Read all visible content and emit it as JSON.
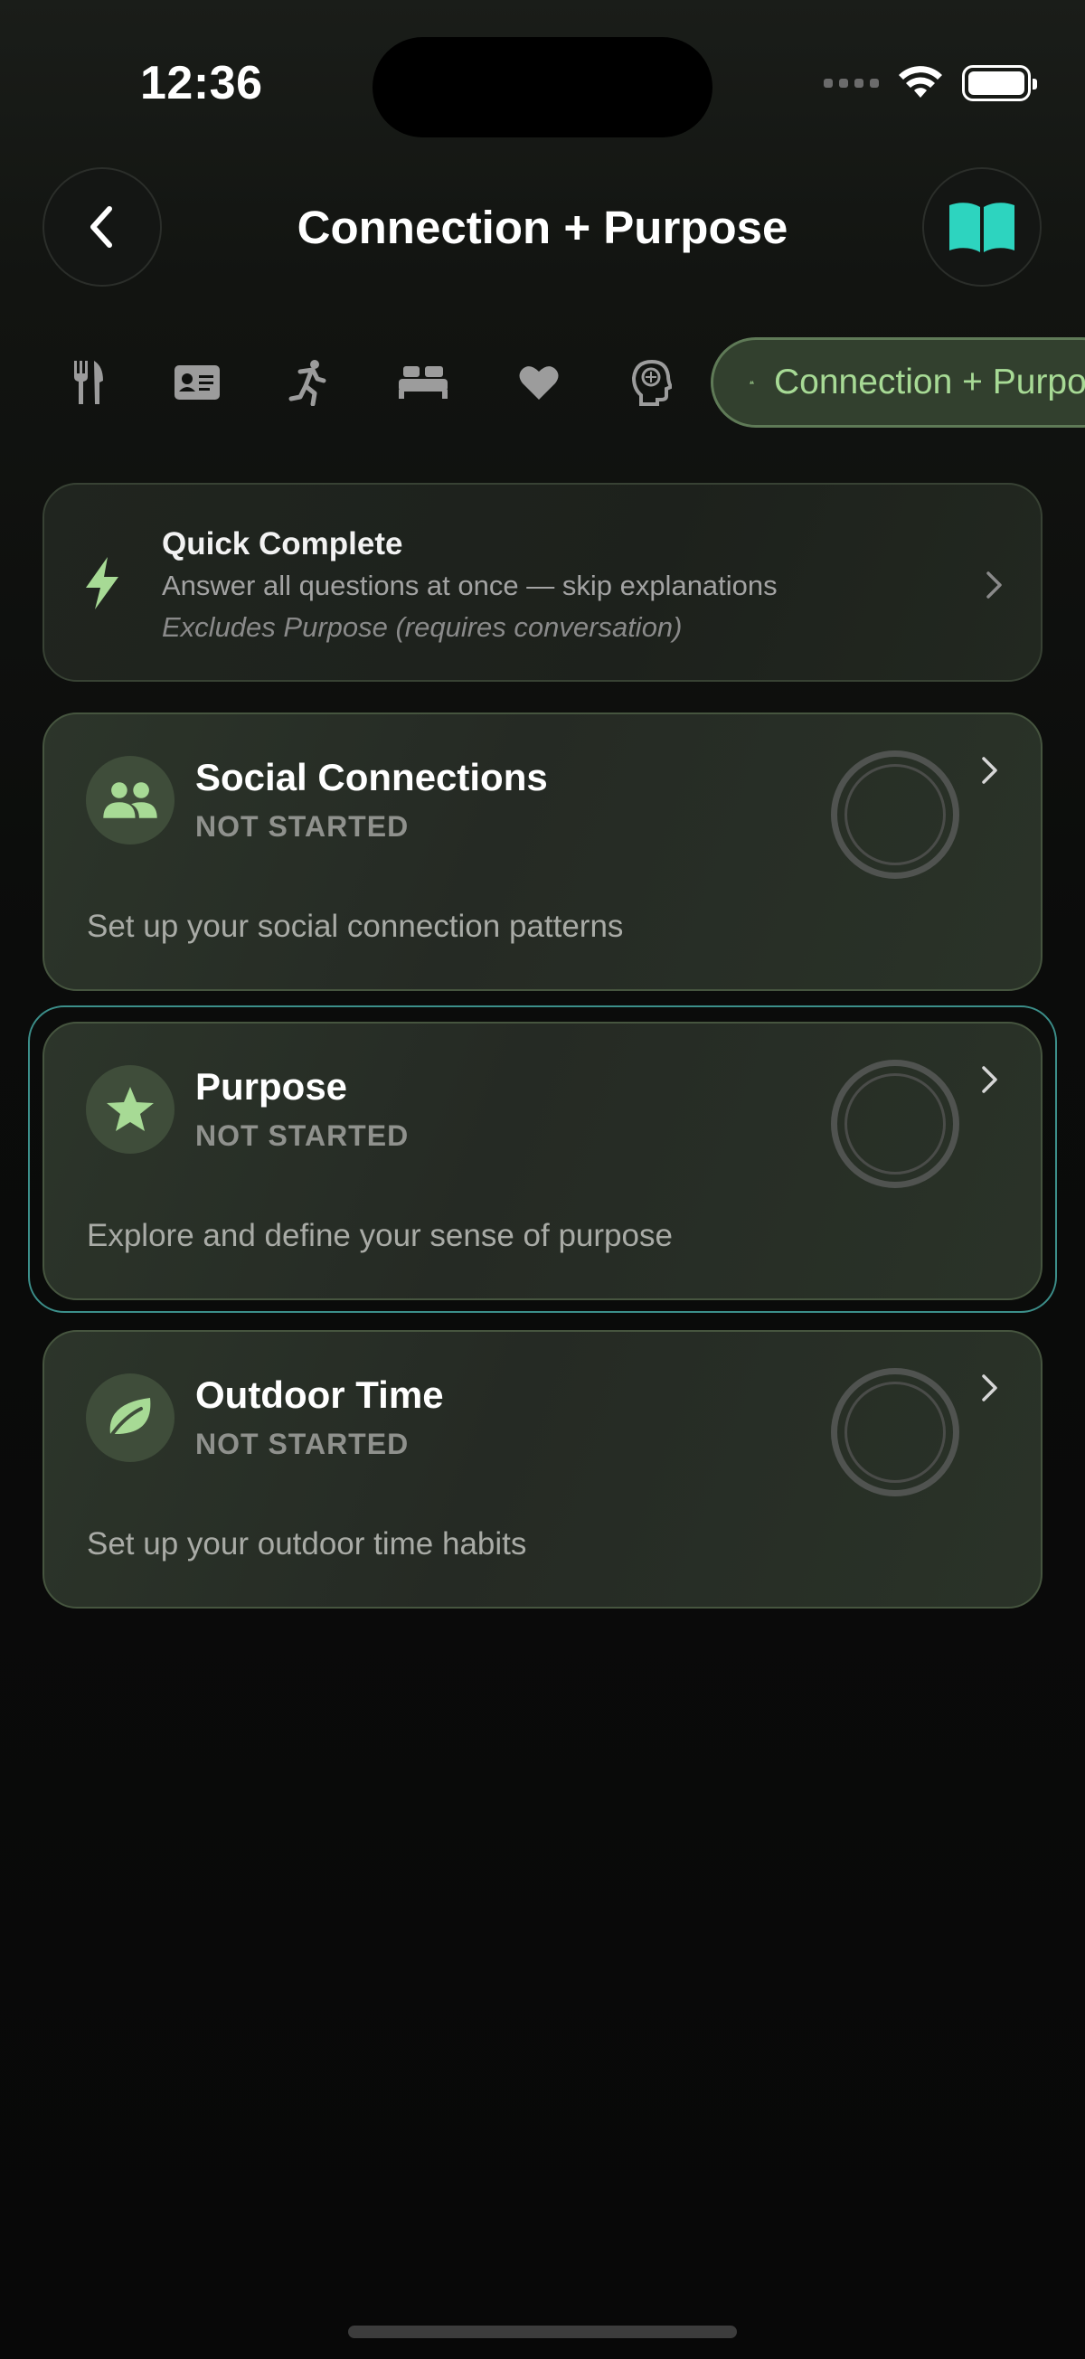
{
  "status_bar": {
    "time": "12:36"
  },
  "header": {
    "title": "Connection + Purpose"
  },
  "tabs": {
    "icons": [
      "fork-knife-icon",
      "id-card-icon",
      "running-icon",
      "bed-icon",
      "heart-icon",
      "brain-icon"
    ],
    "active_label": "Connection + Purpose"
  },
  "quick_complete": {
    "title": "Quick Complete",
    "subtitle": "Answer all questions at once — skip explanations",
    "note": "Excludes Purpose (requires conversation)"
  },
  "sections": [
    {
      "title": "Social Connections",
      "status": "NOT STARTED",
      "description": "Set up your social connection patterns",
      "icon": "people-icon"
    },
    {
      "title": "Purpose",
      "status": "NOT STARTED",
      "description": "Explore and define your sense of purpose",
      "icon": "star-icon"
    },
    {
      "title": "Outdoor Time",
      "status": "NOT STARTED",
      "description": "Set up your outdoor time habits",
      "icon": "leaf-icon"
    }
  ],
  "colors": {
    "accent_green": "#a7da95",
    "book_teal": "#2dd4bf",
    "highlight_border": "#3c8f8a"
  }
}
